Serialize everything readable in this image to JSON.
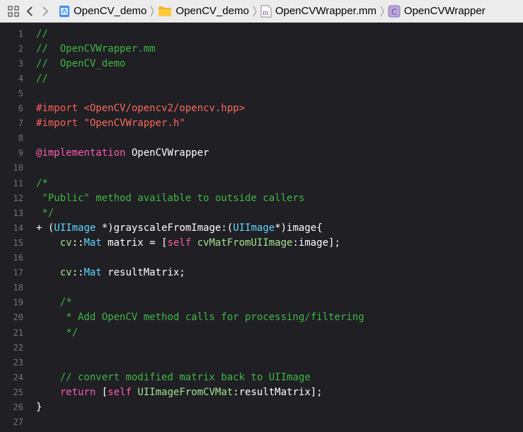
{
  "jump_bar": {
    "breadcrumbs": [
      {
        "label": "OpenCV_demo",
        "icon": "project-icon"
      },
      {
        "label": "OpenCV_demo",
        "icon": "folder-icon"
      },
      {
        "label": "OpenCVWrapper.mm",
        "icon": "objc-file-icon"
      },
      {
        "label": "OpenCVWrapper",
        "icon": "class-icon"
      }
    ]
  },
  "editor": {
    "line_numbers": [
      "1",
      "2",
      "3",
      "4",
      "5",
      "6",
      "7",
      "8",
      "9",
      "10",
      "11",
      "12",
      "13",
      "14",
      "15",
      "16",
      "17",
      "18",
      "19",
      "20",
      "21",
      "22",
      "23",
      "24",
      "25",
      "26",
      "27"
    ],
    "lines": [
      [
        {
          "t": "//",
          "c": "comment"
        }
      ],
      [
        {
          "t": "//  OpenCVWrapper.mm",
          "c": "comment"
        }
      ],
      [
        {
          "t": "//  OpenCV_demo",
          "c": "comment"
        }
      ],
      [
        {
          "t": "//",
          "c": "comment"
        }
      ],
      [],
      [
        {
          "t": "#import ",
          "c": "pre"
        },
        {
          "t": "<OpenCV/opencv2/opencv.hpp>",
          "c": "str"
        }
      ],
      [
        {
          "t": "#import ",
          "c": "pre"
        },
        {
          "t": "\"OpenCVWrapper.h\"",
          "c": "str"
        }
      ],
      [],
      [
        {
          "t": "@implementation",
          "c": "kw"
        },
        {
          "t": " OpenCVWrapper",
          "c": "plain"
        }
      ],
      [],
      [
        {
          "t": "/*",
          "c": "comment"
        }
      ],
      [
        {
          "t": " \"Public\" method available to outside callers",
          "c": "comment"
        }
      ],
      [
        {
          "t": " */",
          "c": "comment"
        }
      ],
      [
        {
          "t": "+ (",
          "c": "plain"
        },
        {
          "t": "UIImage",
          "c": "type"
        },
        {
          "t": " *)grayscaleFromImage:(",
          "c": "plain"
        },
        {
          "t": "UIImage",
          "c": "type"
        },
        {
          "t": "*)image{",
          "c": "plain"
        }
      ],
      [
        {
          "t": "    ",
          "c": "plain"
        },
        {
          "t": "cv",
          "c": "fn"
        },
        {
          "t": "::",
          "c": "plain"
        },
        {
          "t": "Mat",
          "c": "type"
        },
        {
          "t": " matrix = [",
          "c": "plain"
        },
        {
          "t": "self",
          "c": "kw"
        },
        {
          "t": " ",
          "c": "plain"
        },
        {
          "t": "cvMatFromUIImage",
          "c": "fn"
        },
        {
          "t": ":image];",
          "c": "plain"
        }
      ],
      [],
      [
        {
          "t": "    ",
          "c": "plain"
        },
        {
          "t": "cv",
          "c": "fn"
        },
        {
          "t": "::",
          "c": "plain"
        },
        {
          "t": "Mat",
          "c": "type"
        },
        {
          "t": " resultMatrix;",
          "c": "plain"
        }
      ],
      [],
      [
        {
          "t": "    /*",
          "c": "comment"
        }
      ],
      [
        {
          "t": "     * Add OpenCV method calls for processing/filtering",
          "c": "comment"
        }
      ],
      [
        {
          "t": "     */",
          "c": "comment"
        }
      ],
      [],
      [],
      [
        {
          "t": "    // convert modified matrix back to UIImage",
          "c": "comment"
        }
      ],
      [
        {
          "t": "    ",
          "c": "plain"
        },
        {
          "t": "return",
          "c": "kw"
        },
        {
          "t": " [",
          "c": "plain"
        },
        {
          "t": "self",
          "c": "kw"
        },
        {
          "t": " ",
          "c": "plain"
        },
        {
          "t": "UIImageFromCVMat",
          "c": "fn"
        },
        {
          "t": ":resultMatrix];",
          "c": "plain"
        }
      ],
      [
        {
          "t": "}",
          "c": "plain"
        }
      ],
      []
    ]
  },
  "colors": {
    "background": "#1f1f24",
    "comment": "#41b645",
    "preprocessor": "#fc5f59",
    "string": "#fc6a5d",
    "keyword": "#fc5fa3",
    "type": "#5dd8ff",
    "function": "#a3e38f"
  }
}
